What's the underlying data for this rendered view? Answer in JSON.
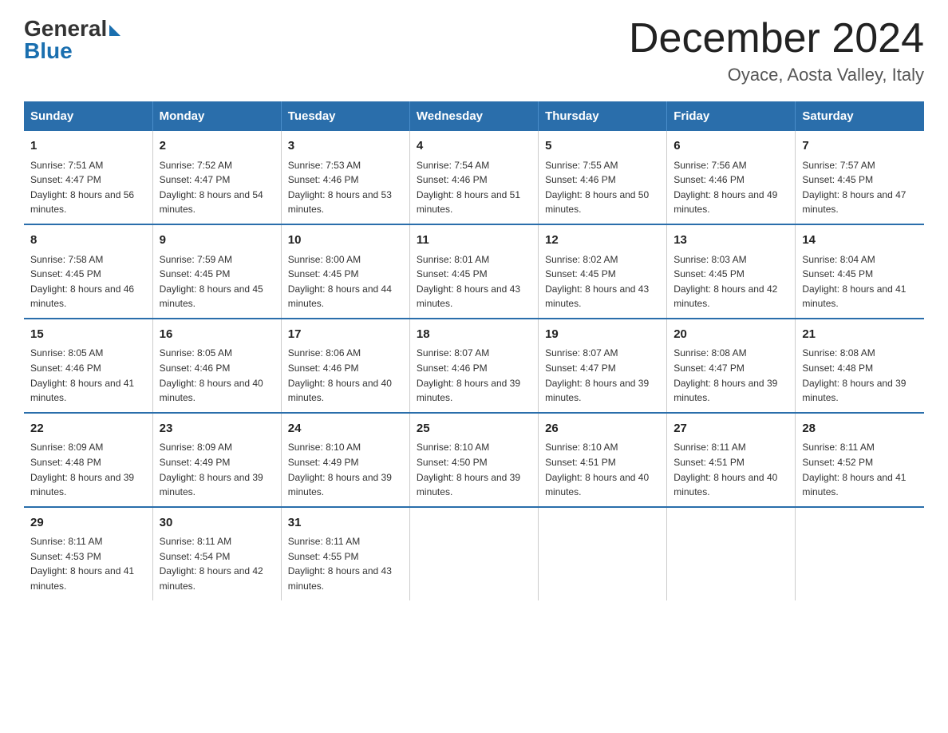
{
  "logo": {
    "general": "General",
    "blue": "Blue"
  },
  "title": "December 2024",
  "location": "Oyace, Aosta Valley, Italy",
  "headers": [
    "Sunday",
    "Monday",
    "Tuesday",
    "Wednesday",
    "Thursday",
    "Friday",
    "Saturday"
  ],
  "weeks": [
    [
      {
        "day": "1",
        "sunrise": "7:51 AM",
        "sunset": "4:47 PM",
        "daylight": "8 hours and 56 minutes."
      },
      {
        "day": "2",
        "sunrise": "7:52 AM",
        "sunset": "4:47 PM",
        "daylight": "8 hours and 54 minutes."
      },
      {
        "day": "3",
        "sunrise": "7:53 AM",
        "sunset": "4:46 PM",
        "daylight": "8 hours and 53 minutes."
      },
      {
        "day": "4",
        "sunrise": "7:54 AM",
        "sunset": "4:46 PM",
        "daylight": "8 hours and 51 minutes."
      },
      {
        "day": "5",
        "sunrise": "7:55 AM",
        "sunset": "4:46 PM",
        "daylight": "8 hours and 50 minutes."
      },
      {
        "day": "6",
        "sunrise": "7:56 AM",
        "sunset": "4:46 PM",
        "daylight": "8 hours and 49 minutes."
      },
      {
        "day": "7",
        "sunrise": "7:57 AM",
        "sunset": "4:45 PM",
        "daylight": "8 hours and 47 minutes."
      }
    ],
    [
      {
        "day": "8",
        "sunrise": "7:58 AM",
        "sunset": "4:45 PM",
        "daylight": "8 hours and 46 minutes."
      },
      {
        "day": "9",
        "sunrise": "7:59 AM",
        "sunset": "4:45 PM",
        "daylight": "8 hours and 45 minutes."
      },
      {
        "day": "10",
        "sunrise": "8:00 AM",
        "sunset": "4:45 PM",
        "daylight": "8 hours and 44 minutes."
      },
      {
        "day": "11",
        "sunrise": "8:01 AM",
        "sunset": "4:45 PM",
        "daylight": "8 hours and 43 minutes."
      },
      {
        "day": "12",
        "sunrise": "8:02 AM",
        "sunset": "4:45 PM",
        "daylight": "8 hours and 43 minutes."
      },
      {
        "day": "13",
        "sunrise": "8:03 AM",
        "sunset": "4:45 PM",
        "daylight": "8 hours and 42 minutes."
      },
      {
        "day": "14",
        "sunrise": "8:04 AM",
        "sunset": "4:45 PM",
        "daylight": "8 hours and 41 minutes."
      }
    ],
    [
      {
        "day": "15",
        "sunrise": "8:05 AM",
        "sunset": "4:46 PM",
        "daylight": "8 hours and 41 minutes."
      },
      {
        "day": "16",
        "sunrise": "8:05 AM",
        "sunset": "4:46 PM",
        "daylight": "8 hours and 40 minutes."
      },
      {
        "day": "17",
        "sunrise": "8:06 AM",
        "sunset": "4:46 PM",
        "daylight": "8 hours and 40 minutes."
      },
      {
        "day": "18",
        "sunrise": "8:07 AM",
        "sunset": "4:46 PM",
        "daylight": "8 hours and 39 minutes."
      },
      {
        "day": "19",
        "sunrise": "8:07 AM",
        "sunset": "4:47 PM",
        "daylight": "8 hours and 39 minutes."
      },
      {
        "day": "20",
        "sunrise": "8:08 AM",
        "sunset": "4:47 PM",
        "daylight": "8 hours and 39 minutes."
      },
      {
        "day": "21",
        "sunrise": "8:08 AM",
        "sunset": "4:48 PM",
        "daylight": "8 hours and 39 minutes."
      }
    ],
    [
      {
        "day": "22",
        "sunrise": "8:09 AM",
        "sunset": "4:48 PM",
        "daylight": "8 hours and 39 minutes."
      },
      {
        "day": "23",
        "sunrise": "8:09 AM",
        "sunset": "4:49 PM",
        "daylight": "8 hours and 39 minutes."
      },
      {
        "day": "24",
        "sunrise": "8:10 AM",
        "sunset": "4:49 PM",
        "daylight": "8 hours and 39 minutes."
      },
      {
        "day": "25",
        "sunrise": "8:10 AM",
        "sunset": "4:50 PM",
        "daylight": "8 hours and 39 minutes."
      },
      {
        "day": "26",
        "sunrise": "8:10 AM",
        "sunset": "4:51 PM",
        "daylight": "8 hours and 40 minutes."
      },
      {
        "day": "27",
        "sunrise": "8:11 AM",
        "sunset": "4:51 PM",
        "daylight": "8 hours and 40 minutes."
      },
      {
        "day": "28",
        "sunrise": "8:11 AM",
        "sunset": "4:52 PM",
        "daylight": "8 hours and 41 minutes."
      }
    ],
    [
      {
        "day": "29",
        "sunrise": "8:11 AM",
        "sunset": "4:53 PM",
        "daylight": "8 hours and 41 minutes."
      },
      {
        "day": "30",
        "sunrise": "8:11 AM",
        "sunset": "4:54 PM",
        "daylight": "8 hours and 42 minutes."
      },
      {
        "day": "31",
        "sunrise": "8:11 AM",
        "sunset": "4:55 PM",
        "daylight": "8 hours and 43 minutes."
      },
      null,
      null,
      null,
      null
    ]
  ]
}
